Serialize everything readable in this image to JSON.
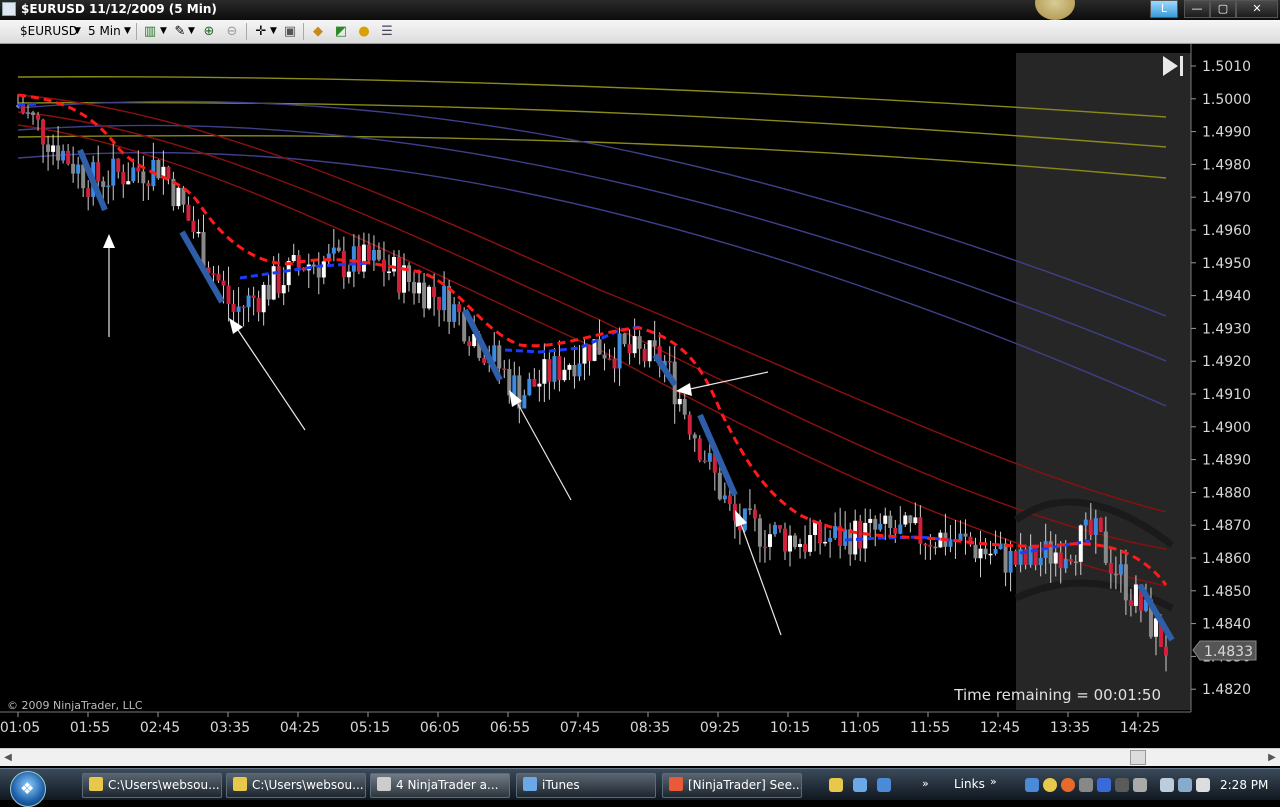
{
  "window": {
    "title": "$EURUSD  11/12/2009 (5 Min)",
    "buttons": {
      "minimize": "—",
      "maximize": "▢",
      "close": "✕",
      "extra": "L"
    }
  },
  "toolbar": {
    "instrument": "$EURUSD",
    "interval": "5 Min",
    "icons": [
      "candlestick-chart-icon",
      "draw-tool-icon",
      "zoom-in-icon",
      "zoom-out-icon",
      "crosshair-icon",
      "data-box-icon",
      "indicators-icon",
      "strategies-icon",
      "currency-icon",
      "properties-icon"
    ]
  },
  "chart": {
    "copyright": "© 2009 NinjaTrader, LLC",
    "time_remaining": "Time remaining = 00:01:50",
    "last_price": "1.4833",
    "y_axis": [
      "1.5010",
      "1.5000",
      "1.4990",
      "1.4980",
      "1.4970",
      "1.4960",
      "1.4950",
      "1.4940",
      "1.4930",
      "1.4920",
      "1.4910",
      "1.4900",
      "1.4890",
      "1.4880",
      "1.4870",
      "1.4860",
      "1.4850",
      "1.4840",
      "1.4830",
      "1.4820"
    ],
    "x_axis": [
      "01:05",
      "01:55",
      "02:45",
      "03:35",
      "04:25",
      "05:15",
      "06:05",
      "06:55",
      "07:45",
      "08:35",
      "09:25",
      "10:15",
      "11:05",
      "11:55",
      "12:45",
      "13:35",
      "14:25"
    ],
    "colors": {
      "up": "#3d8be0",
      "down": "#d0203a",
      "neutral_up": "#ffffff",
      "neutral_down": "#888888",
      "ma_fast": "#ff1a1a",
      "ma_trend": "#1a3cff"
    }
  },
  "chart_data": {
    "type": "line",
    "title": "",
    "xlabel": "",
    "ylabel": "",
    "ylim": [
      1.4815,
      1.5013
    ],
    "x": [
      "01:05",
      "01:55",
      "02:45",
      "03:35",
      "04:25",
      "05:15",
      "06:05",
      "06:55",
      "07:45",
      "08:35",
      "09:25",
      "10:15",
      "11:05",
      "11:55",
      "12:45",
      "13:35",
      "14:25"
    ],
    "series": [
      {
        "values": [
          1.4998,
          1.4975,
          1.498,
          1.4935,
          1.495,
          1.495,
          1.4938,
          1.491,
          1.4925,
          1.492,
          1.487,
          1.4865,
          1.4868,
          1.4866,
          1.4858,
          1.4867,
          1.4833
        ]
      }
    ]
  },
  "scrollbar": {
    "left": "◀",
    "right": "▶"
  },
  "taskbar": {
    "start": "❖",
    "tasks": [
      {
        "label": "C:\\Users\\websou...",
        "icon_color": "#e8c84a"
      },
      {
        "label": "C:\\Users\\websou...",
        "icon_color": "#e8c84a"
      },
      {
        "label": "4 NinjaTrader a...",
        "icon_color": "#cccccc"
      },
      {
        "label": "iTunes",
        "icon_color": "#6aa8e8"
      },
      {
        "label": "[NinjaTrader] See...",
        "icon_color": "#e85a3a"
      }
    ],
    "links": "Links",
    "clock": "2:28 PM"
  }
}
